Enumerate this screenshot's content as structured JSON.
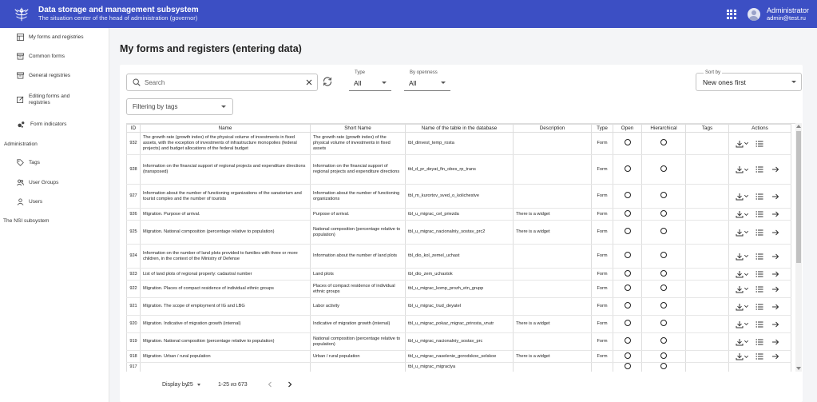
{
  "header": {
    "title": "Data storage and management subsystem",
    "subtitle": "The situation center of the head of administration (governor)",
    "user_name": "Administrator",
    "user_email": "admin@test.ru",
    "color": "#3c4fc4"
  },
  "sidebar": {
    "items": [
      {
        "label": "My forms and registries",
        "icon": "table-icon"
      },
      {
        "label": "Common forms",
        "icon": "inbox-icon"
      },
      {
        "label": "General registries",
        "icon": "inbox-icon"
      },
      {
        "label": "Editing forms and registries",
        "icon": "edit-icon"
      },
      {
        "label": "Form indicators",
        "icon": "bubbles-icon"
      }
    ],
    "admin_section": "Administration",
    "admin_items": [
      {
        "label": "Tags",
        "icon": "tag-icon"
      },
      {
        "label": "User Groups",
        "icon": "user-group-icon"
      },
      {
        "label": "Users",
        "icon": "user-icon"
      }
    ],
    "nsi_section": "The NSI subsystem"
  },
  "main": {
    "title": "My forms and registers (entering data)",
    "search_placeholder": "Search",
    "type_filter": {
      "label": "Type",
      "value": "All"
    },
    "openness_filter": {
      "label": "By openness",
      "value": "All"
    },
    "sort": {
      "label": "Sort by",
      "value": "New ones first"
    },
    "tags_filter": "Filtering by tags"
  },
  "table": {
    "columns": [
      "ID",
      "Name",
      "Short Name",
      "Name of the table in the database",
      "Description",
      "Type",
      "Open",
      "Hierarchical",
      "Tags",
      "Actions"
    ],
    "rows": [
      {
        "id": "932",
        "name": "The growth rate (growth index) of the physical volume of investments in fixed assets, with the exception of investments of infrastructure monopolies (federal projects) and budget allocations of the federal budget",
        "short": "The growth rate (growth index) of the physical volume of investments in fixed assets",
        "db": "tbl_dinvest_temp_rosta",
        "desc": "",
        "type": "Form"
      },
      {
        "id": "928",
        "name": "Information on the financial support of regional projects and expenditure directions (transposed)",
        "short": "Information on the financial support of regional projects and expenditure directions",
        "db": "tbl_d_pr_deyat_fin_obes_rp_trans",
        "desc": "",
        "type": "Form"
      },
      {
        "id": "927",
        "name": "Information about the number of functioning organizations of the sanatorium and tourist complex and the number of tourists",
        "short": "Information about the number of functioning organizations",
        "db": "tbl_m_kurortov_sved_o_kolichestve",
        "desc": "",
        "type": "Form"
      },
      {
        "id": "926",
        "name": "Migration. Purpose of arrival.",
        "short": "Purpose of arrival.",
        "db": "tbl_u_migrac_cel_priezda",
        "desc": "There is a widget",
        "type": "Form"
      },
      {
        "id": "925",
        "name": "Migration. National composition (percentage relative to population)",
        "short": "National composition (percentage relative to population)",
        "db": "tbl_u_migrac_nacionalniy_sostav_prc2",
        "desc": "There is a widget",
        "type": "Form"
      },
      {
        "id": "924",
        "name": "Information on the number of land plots provided to families with three or more children, in the context of the Ministry of Defense",
        "short": "Information about the number of land plots",
        "db": "tbl_dio_kol_zemel_uchast",
        "desc": "",
        "type": "Form"
      },
      {
        "id": "923",
        "name": "List of land plots of regional property: cadastral number",
        "short": "Land plots",
        "db": "tbl_dio_zem_uchastok",
        "desc": "",
        "type": "Form"
      },
      {
        "id": "922",
        "name": "Migration. Places of compact residence of individual ethnic groups",
        "short": "Places of compact residence of individual ethnic groups",
        "db": "tbl_u_migrac_komp_prozh_etn_grupp",
        "desc": "",
        "type": "Form"
      },
      {
        "id": "921",
        "name": "Migration. The scope of employment of IG and LBG",
        "short": "Labor activity",
        "db": "tbl_u_migrac_trud_deyatel",
        "desc": "",
        "type": "Form"
      },
      {
        "id": "920",
        "name": "Migration. Indicative of migration growth (internal)",
        "short": "Indicative of migration growth (internal)",
        "db": "tbl_u_migrac_pokaz_migrac_prirosta_vnutr",
        "desc": "There is a widget",
        "type": "Form"
      },
      {
        "id": "919",
        "name": "Migration. National composition (percentage relative to population)",
        "short": "National composition (percentage relative to population)",
        "db": "tbl_u_migrac_nacionalniy_sostav_prc",
        "desc": "",
        "type": "Form"
      },
      {
        "id": "918",
        "name": "Migration. Urban / rural population",
        "short": "Urban / rural population",
        "db": "tbl_u_migrac_naselenie_gorodskoe_selskoe",
        "desc": "There is a widget",
        "type": "Form"
      },
      {
        "id": "917",
        "name": "",
        "short": "",
        "db": "tbl_u_migrac_migraciya",
        "desc": "",
        "type": ""
      }
    ]
  },
  "pagination": {
    "label": "Display by",
    "page_size": "25",
    "range": "1-25 из 673"
  }
}
